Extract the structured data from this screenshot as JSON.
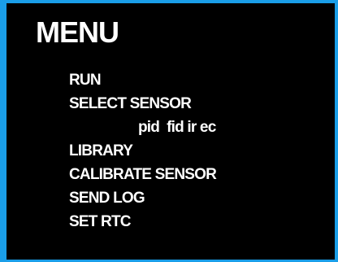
{
  "title": "MENU",
  "menu": {
    "items": [
      {
        "label": "RUN"
      },
      {
        "label": "SELECT SENSOR"
      },
      {
        "label": "LIBRARY"
      },
      {
        "label": "CALIBRATE SENSOR"
      },
      {
        "label": "SEND LOG"
      },
      {
        "label": "SET RTC"
      }
    ],
    "sensor_options": [
      "pid",
      "fid",
      "ir",
      "ec"
    ]
  },
  "colors": {
    "frame": "#1a9ee8",
    "background": "#000000",
    "text": "#ffffff"
  }
}
